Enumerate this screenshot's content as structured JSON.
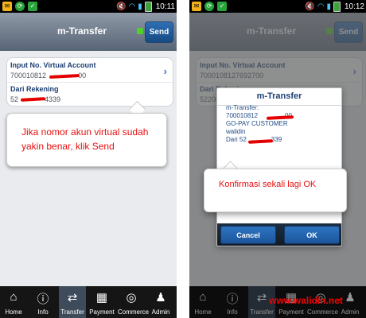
{
  "status_time": {
    "left": "10:11",
    "right": "10:12"
  },
  "title": "m-Transfer",
  "send_label": "Send",
  "fields": [
    {
      "label": "Input No. Virtual Account",
      "value": "700010812",
      "tail": "00"
    },
    {
      "label": "Dari Rekening",
      "value": "52",
      "tail": "4339"
    }
  ],
  "dimmed_fields": [
    {
      "label": "Input No. Virtual Account",
      "value": "7000108127692700"
    },
    {
      "label": "Dari Rekening",
      "value": "52200"
    }
  ],
  "tip_left": "Jika nomor akun virtual sudah yakin benar, klik Send",
  "dialog": {
    "title": "m-Transfer",
    "lines": [
      "m-Transfer:",
      "700010812",
      "00",
      "GO-PAY CUSTOMER",
      "walidin",
      "Dari 52",
      "339"
    ]
  },
  "tip_right": "Konfirmasi sekali lagi OK",
  "buttons": {
    "cancel": "Cancel",
    "ok": "OK"
  },
  "tabs": [
    "Home",
    "Info",
    "Transfer",
    "Payment",
    "Commerce",
    "Admin"
  ],
  "watermark": "www.walidin.net",
  "colors": {
    "accent": "#1d3f73",
    "alert": "#e80f10",
    "active_tab": "#3d4b5b"
  }
}
